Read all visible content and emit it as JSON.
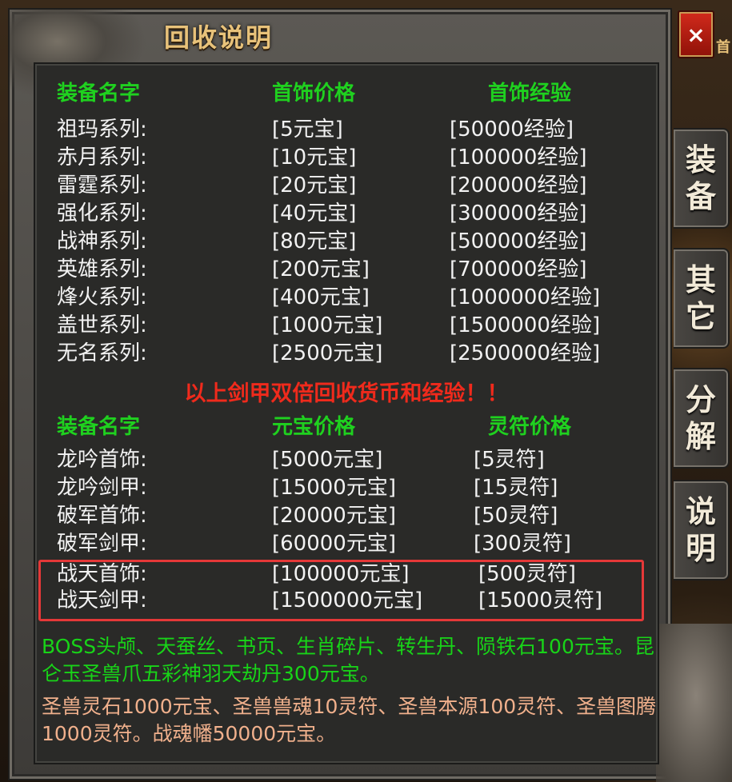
{
  "window": {
    "title": "回收说明",
    "close_label": "×",
    "side_peek": "首"
  },
  "tabs": [
    {
      "chars": [
        "装",
        "备"
      ]
    },
    {
      "chars": [
        "其",
        "它"
      ]
    },
    {
      "chars": [
        "分",
        "解"
      ]
    },
    {
      "chars": [
        "说",
        "明"
      ]
    }
  ],
  "table1": {
    "headers": [
      "装备名字",
      "首饰价格",
      "首饰经验"
    ],
    "rows": [
      [
        "祖玛系列:",
        "[5元宝]",
        "[50000经验]"
      ],
      [
        "赤月系列:",
        "[10元宝]",
        "[100000经验]"
      ],
      [
        "雷霆系列:",
        "[20元宝]",
        "[200000经验]"
      ],
      [
        "强化系列:",
        "[40元宝]",
        "[300000经验]"
      ],
      [
        "战神系列:",
        "[80元宝]",
        "[500000经验]"
      ],
      [
        "英雄系列:",
        "[200元宝]",
        "[700000经验]"
      ],
      [
        "烽火系列:",
        "[400元宝]",
        "[1000000经验]"
      ],
      [
        "盖世系列:",
        "[1000元宝]",
        "[1500000经验]"
      ],
      [
        "无名系列:",
        "[2500元宝]",
        "[2500000经验]"
      ]
    ]
  },
  "notice": "以上剑甲双倍回收货币和经验！！",
  "table2": {
    "headers": [
      "装备名字",
      "元宝价格",
      "灵符价格"
    ],
    "rows": [
      [
        "龙吟首饰:",
        "[5000元宝]",
        "[5灵符]"
      ],
      [
        "龙吟剑甲:",
        "[15000元宝]",
        "[15灵符]"
      ],
      [
        "破军首饰:",
        "[20000元宝]",
        "[50灵符]"
      ],
      [
        "破军剑甲:",
        "[60000元宝]",
        "[300灵符]"
      ],
      [
        "战天首饰:",
        "[100000元宝]",
        "[500灵符]"
      ],
      [
        "战天剑甲:",
        "[1500000元宝]",
        "[15000灵符]"
      ]
    ]
  },
  "paragraphs": {
    "green": "BOSS头颅、天蚕丝、书页、生肖碎片、转生丹、陨铁石100元宝。昆仑玉圣兽爪五彩神羽天劫丹300元宝。",
    "peach": "圣兽灵石1000元宝、圣兽兽魂10灵符、圣兽本源100灵符、圣兽图腾1000灵符。战魂幡50000元宝。"
  },
  "colors": {
    "header_green": "#1fd11f",
    "notice_red": "#f02a1c",
    "highlight_red": "#e53838",
    "peach_text": "#f0b08c",
    "title_gold": "#e8c27a"
  }
}
